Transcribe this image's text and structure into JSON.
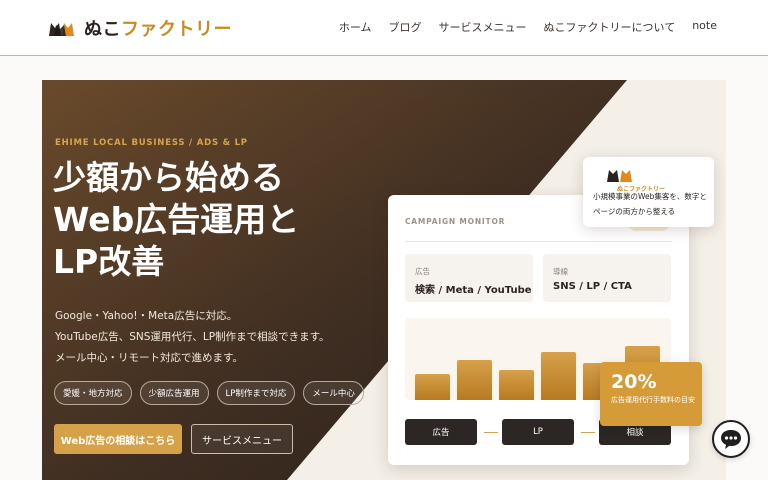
{
  "brand": {
    "logo_prefix": "ぬこ",
    "logo_suffix": "ファクトリー",
    "accent": "#c98a1e"
  },
  "nav": [
    "ホーム",
    "ブログ",
    "サービスメニュー",
    "ぬこファクトリーについて",
    "note"
  ],
  "hero": {
    "eyebrow": "EHIME LOCAL BUSINESS / ADS & LP",
    "title_lines": [
      "少額から始める",
      "Web広告運用と",
      "LP改善"
    ],
    "description": [
      "Google・Yahoo!・Meta広告に対応。",
      "YouTube広告、SNS運用代行、LP制作まで相談できます。",
      "メール中心・リモート対応で進めます。"
    ],
    "chips": [
      "愛媛・地方対応",
      "少額広告運用",
      "LP制作まで対応",
      "メール中心"
    ],
    "primary_button": "Web広告の相談はこちら",
    "secondary_button": "サービスメニュー"
  },
  "panel": {
    "label": "CAMPAIGN MONITOR",
    "cards": [
      {
        "key": "広告",
        "value": "検索 / Meta / YouTube"
      },
      {
        "key": "導線",
        "value": "SNS / LP / CTA"
      }
    ],
    "bar_levels": [
      0.34,
      0.52,
      0.4,
      0.63,
      0.48,
      0.71
    ],
    "flow": [
      "広告",
      "LP",
      "相談"
    ]
  },
  "note_card": {
    "brand": "ぬこファクトリー",
    "text": "小規模事業のWeb集客を、数字とページの両方から整える"
  },
  "badge": {
    "value": "20%",
    "label": "広告運用代行手数料の目安"
  },
  "icons": {
    "chat": "chat-icon",
    "logo": "cat-logo-icon"
  }
}
